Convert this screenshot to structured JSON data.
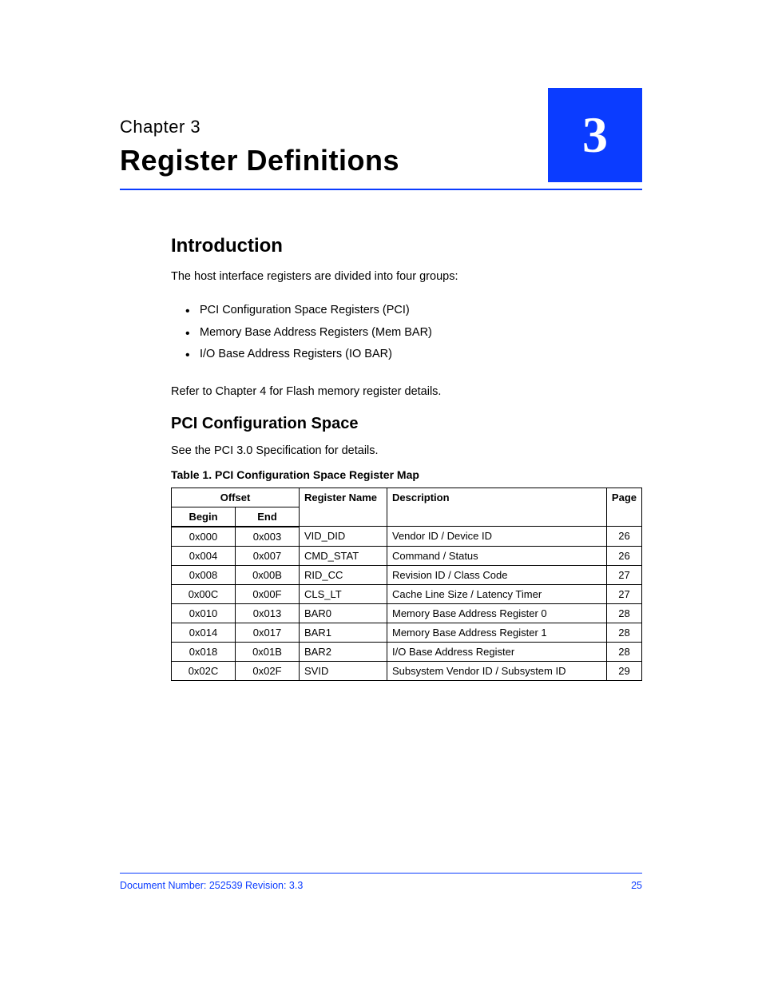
{
  "header": {
    "kicker": "Chapter 3",
    "title": "Register Definitions",
    "badge": "3"
  },
  "intro": {
    "heading": "Introduction",
    "paragraph": "The host interface registers are divided into four groups:",
    "bullets": [
      "PCI Configuration Space Registers (PCI)",
      "Memory Base Address Registers (Mem BAR)",
      "I/O Base Address Registers (IO BAR)"
    ],
    "note": "Refer to Chapter 4 for Flash memory register details."
  },
  "pci": {
    "heading": "PCI Configuration Space",
    "ref": "See the PCI 3.0 Specification for details.",
    "tableTitle": "Table 1.   PCI Configuration Space Register Map"
  },
  "table": {
    "headers": {
      "offset": "Offset",
      "begin": "Begin",
      "end": "End",
      "name": "Register Name",
      "desc": "Description",
      "page": "Page"
    },
    "rows": [
      {
        "begin": "0x000",
        "end": "0x003",
        "name": "VID_DID",
        "desc": "Vendor ID / Device ID",
        "page": "26"
      },
      {
        "begin": "0x004",
        "end": "0x007",
        "name": "CMD_STAT",
        "desc": "Command / Status",
        "page": "26"
      },
      {
        "begin": "0x008",
        "end": "0x00B",
        "name": "RID_CC",
        "desc": "Revision ID / Class Code",
        "page": "27"
      },
      {
        "begin": "0x00C",
        "end": "0x00F",
        "name": "CLS_LT",
        "desc": "Cache Line Size / Latency Timer",
        "page": "27"
      },
      {
        "begin": "0x010",
        "end": "0x013",
        "name": "BAR0",
        "desc": "Memory Base Address Register 0",
        "page": "28"
      },
      {
        "begin": "0x014",
        "end": "0x017",
        "name": "BAR1",
        "desc": "Memory Base Address Register 1",
        "page": "28"
      },
      {
        "begin": "0x018",
        "end": "0x01B",
        "name": "BAR2",
        "desc": "I/O Base Address Register",
        "page": "28"
      },
      {
        "begin": "0x02C",
        "end": "0x02F",
        "name": "SVID",
        "desc": "Subsystem Vendor ID / Subsystem ID",
        "page": "29"
      }
    ]
  },
  "footer": {
    "left": "Document Number: 252539  Revision: 3.3",
    "rightTop": "25",
    "rightBottom": ""
  }
}
